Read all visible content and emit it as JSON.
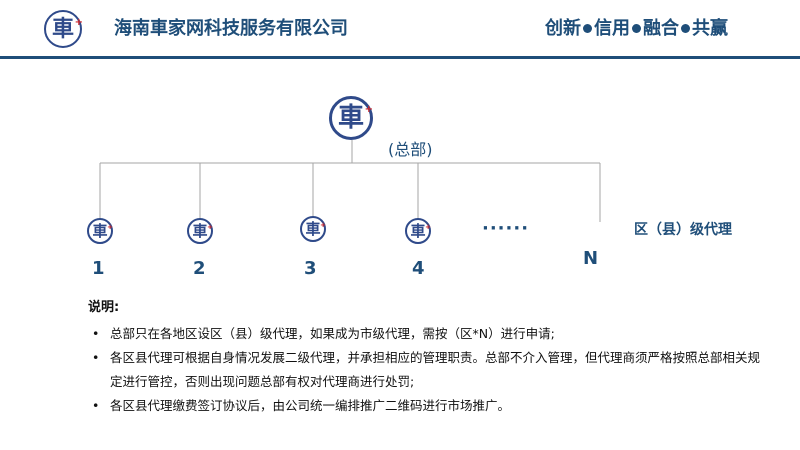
{
  "header": {
    "company": "海南車家网科技服务有限公司",
    "slogan": [
      "创新",
      "信用",
      "融合",
      "共赢"
    ]
  },
  "logo": {
    "glyph": "車",
    "plus": "+"
  },
  "diagram": {
    "hq_label": "(总部)",
    "branches": [
      "1",
      "2",
      "3",
      "4"
    ],
    "ellipsis": "······",
    "last": "N",
    "agent_label": "区（县）级代理"
  },
  "notes": {
    "title": "说明:",
    "items": [
      "总部只在各地区设区（县）级代理，如果成为市级代理，需按（区*N）进行申请;",
      "各区县代理可根据自身情况发展二级代理，并承担相应的管理职责。总部不介入管理，但代理商须严格按照总部相关规定进行管控，否则出现问题总部有权对代理商进行处罚;",
      "各区县代理缴费签订协议后，由公司统一编排推广二维码进行市场推广。"
    ]
  },
  "colors": {
    "primary": "#1f4e79",
    "logo": "#2f4a8a",
    "accent": "#d0262b"
  }
}
